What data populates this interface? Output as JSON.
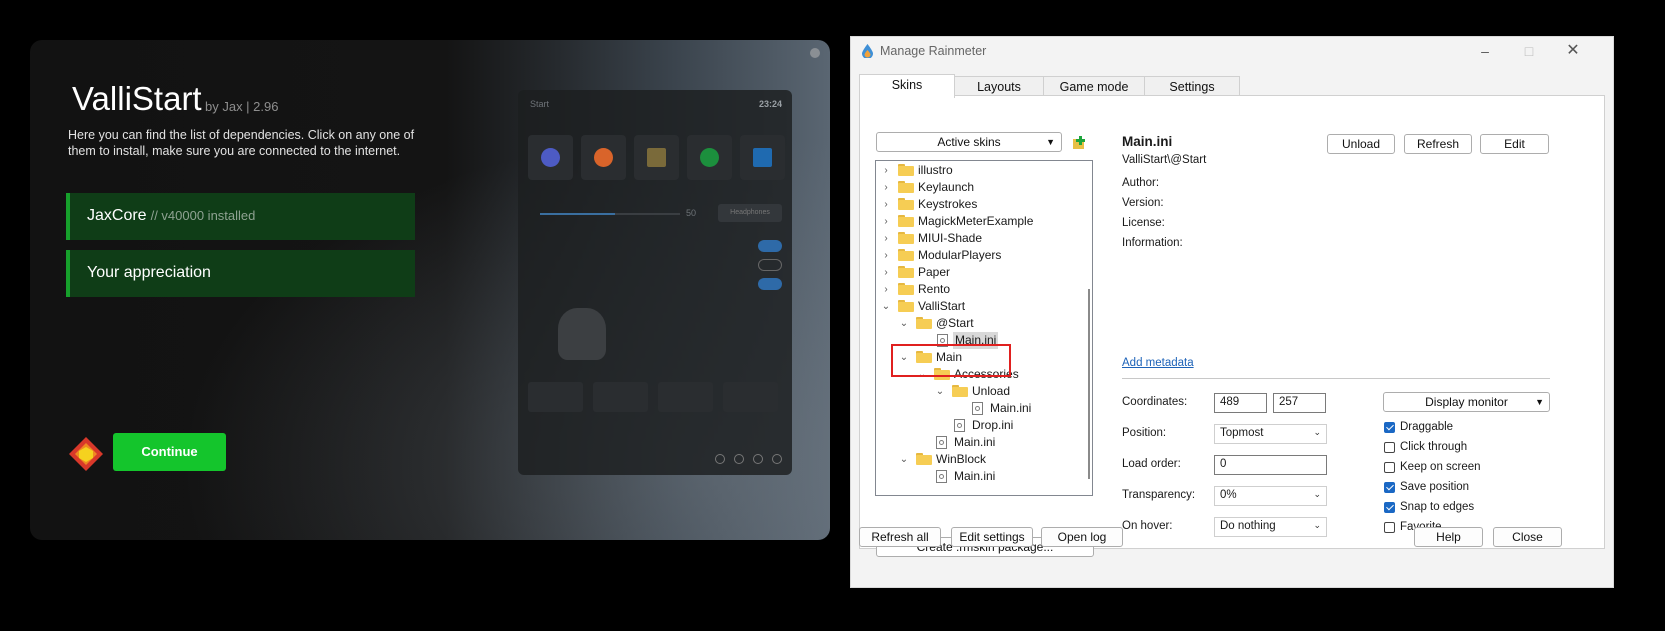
{
  "installer": {
    "title": "ValliStart",
    "byline": "by Jax | 2.96",
    "description": "Here you can find the list of dependencies. Click on any one of them to install, make sure you are connected to the internet.",
    "dependencies": [
      {
        "label": "JaxCore",
        "sub": "// v40000 installed"
      },
      {
        "label": "Your appreciation",
        "sub": ""
      }
    ],
    "continue_label": "Continue",
    "preview": {
      "title": "Start",
      "time": "23:24",
      "volume_value": "50",
      "output_label": "Headphones"
    }
  },
  "rainmeter": {
    "title": "Manage Rainmeter",
    "tabs": [
      "Skins",
      "Layouts",
      "Game mode",
      "Settings"
    ],
    "active_skins_label": "Active skins",
    "tree": [
      {
        "label": "illustro"
      },
      {
        "label": "Keylaunch"
      },
      {
        "label": "Keystrokes"
      },
      {
        "label": "MagickMeterExample"
      },
      {
        "label": "MIUI-Shade"
      },
      {
        "label": "ModularPlayers"
      },
      {
        "label": "Paper"
      },
      {
        "label": "Rento"
      },
      {
        "label": "ValliStart"
      },
      {
        "label": "@Start"
      },
      {
        "label": "Main.ini"
      },
      {
        "label": "Main"
      },
      {
        "label": "Accessories"
      },
      {
        "label": "Unload"
      },
      {
        "label": "Main.ini"
      },
      {
        "label": "Drop.ini"
      },
      {
        "label": "Main.ini"
      },
      {
        "label": "WinBlock"
      },
      {
        "label": "Main.ini"
      }
    ],
    "create_package_label": "Create .rmskin package...",
    "skin": {
      "name": "Main.ini",
      "path": "ValliStart\\@Start",
      "meta_labels": [
        "Author:",
        "Version:",
        "License:",
        "Information:"
      ],
      "add_metadata_label": "Add metadata"
    },
    "buttons": {
      "unload": "Unload",
      "refresh": "Refresh",
      "edit": "Edit",
      "display_monitor": "Display monitor",
      "refresh_all": "Refresh all",
      "edit_settings": "Edit settings",
      "open_log": "Open log",
      "help": "Help",
      "close": "Close"
    },
    "fields": {
      "coordinates_label": "Coordinates:",
      "x": "489",
      "y": "257",
      "position_label": "Position:",
      "position_value": "Topmost",
      "load_order_label": "Load order:",
      "load_order_value": "0",
      "transparency_label": "Transparency:",
      "transparency_value": "0%",
      "on_hover_label": "On hover:",
      "on_hover_value": "Do nothing"
    },
    "checkboxes": [
      {
        "label": "Draggable",
        "checked": true
      },
      {
        "label": "Click through",
        "checked": false
      },
      {
        "label": "Keep on screen",
        "checked": false
      },
      {
        "label": "Save position",
        "checked": true
      },
      {
        "label": "Snap to edges",
        "checked": true
      },
      {
        "label": "Favorite",
        "checked": false
      }
    ]
  }
}
